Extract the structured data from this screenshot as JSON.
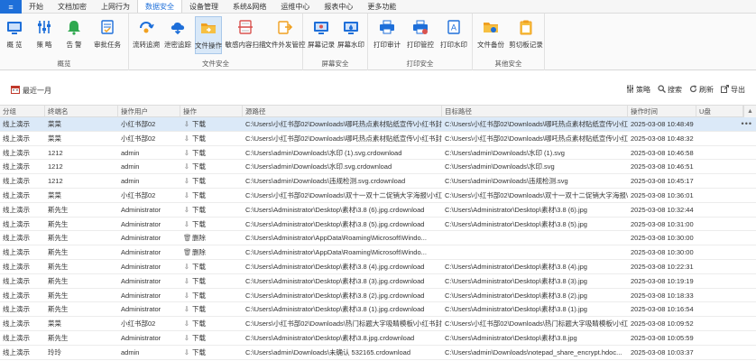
{
  "menubar": {
    "app_label": "≡",
    "tabs": [
      "开始",
      "文档加密",
      "上网行为",
      "数据安全",
      "设备管理",
      "系统&网络",
      "运维中心",
      "报表中心",
      "更多功能"
    ],
    "active_tab": "数据安全"
  },
  "ribbon": {
    "groups": [
      {
        "label": "概览",
        "buttons": [
          {
            "label": "概 览",
            "icon": "overview-icon"
          },
          {
            "label": "策 略",
            "icon": "policy-icon"
          },
          {
            "label": "告 警",
            "icon": "bell-icon"
          },
          {
            "label": "审批任务",
            "icon": "approval-icon"
          }
        ]
      },
      {
        "label": "文件安全",
        "buttons": [
          {
            "label": "流转追溯",
            "icon": "trace-icon"
          },
          {
            "label": "泄密追踪",
            "icon": "leak-icon"
          },
          {
            "label": "文件操作",
            "icon": "folder-icon"
          },
          {
            "label": "敏感内容扫描",
            "icon": "scan-icon"
          },
          {
            "label": "文件外发管控",
            "icon": "outgoing-icon"
          }
        ]
      },
      {
        "label": "屏幕安全",
        "buttons": [
          {
            "label": "屏幕记录",
            "icon": "screen-record-icon"
          },
          {
            "label": "屏幕水印",
            "icon": "watermark-icon"
          }
        ]
      },
      {
        "label": "打印安全",
        "buttons": [
          {
            "label": "打印审计",
            "icon": "printer-icon"
          },
          {
            "label": "打印管控",
            "icon": "print-control-icon"
          },
          {
            "label": "打印水印",
            "icon": "print-watermark-icon"
          }
        ]
      },
      {
        "label": "其他安全",
        "buttons": [
          {
            "label": "文件备份",
            "icon": "backup-icon"
          },
          {
            "label": "剪切板记录",
            "icon": "clipboard-icon"
          }
        ]
      }
    ],
    "active_button": "文件操作",
    "colors": {
      "blue": "#1e6fd9",
      "green": "#2fa84f",
      "orange": "#f0a020",
      "red": "#d9534f",
      "active_bg": "#d8e8f8"
    }
  },
  "toolbar": {
    "range_label": "最近一月",
    "tools": [
      {
        "label": "策略",
        "icon": "filter-icon"
      },
      {
        "label": "搜索",
        "icon": "search-icon"
      },
      {
        "label": "刷新",
        "icon": "refresh-icon"
      },
      {
        "label": "导出",
        "icon": "export-icon"
      }
    ]
  },
  "table": {
    "columns": [
      "分组",
      "终端名",
      "操作用户",
      "操作",
      "源路径",
      "目标路径",
      "操作时间",
      "U盘"
    ],
    "rows": [
      {
        "group": "线上演示",
        "terminal": "菜菜",
        "user": "小红书部02",
        "op": "下载",
        "op_icon": "download-icon",
        "src": "C:\\Users\\小红书部02\\Downloads\\哪吒热点素材贴纸宣传\\小红书封",
        "dst": "C:\\Users\\小红书部02\\Downloads\\哪吒热点素材贴纸宣传\\小红",
        "time": "2025-03-08 10:48:49",
        "selected": true
      },
      {
        "group": "线上演示",
        "terminal": "菜菜",
        "user": "小红书部02",
        "op": "下载",
        "op_icon": "download-icon",
        "src": "C:\\Users\\小红书部02\\Downloads\\哪吒热点素材贴纸宣传\\小红书封",
        "dst": "C:\\Users\\小红书部02\\Downloads\\哪吒热点素材贴纸宣传\\小红",
        "time": "2025-03-08 10:48:32",
        "selected": false
      },
      {
        "group": "线上演示",
        "terminal": "1212",
        "user": "admin",
        "op": "下载",
        "op_icon": "download-icon",
        "src": "C:\\Users\\admin\\Downloads\\水印 (1).svg.crdownload",
        "dst": "C:\\Users\\admin\\Downloads\\水印 (1).svg",
        "time": "2025-03-08 10:46:58",
        "selected": false
      },
      {
        "group": "线上演示",
        "terminal": "1212",
        "user": "admin",
        "op": "下载",
        "op_icon": "download-icon",
        "src": "C:\\Users\\admin\\Downloads\\水印.svg.crdownload",
        "dst": "C:\\Users\\admin\\Downloads\\水印.svg",
        "time": "2025-03-08 10:46:51",
        "selected": false
      },
      {
        "group": "线上演示",
        "terminal": "1212",
        "user": "admin",
        "op": "下载",
        "op_icon": "download-icon",
        "src": "C:\\Users\\admin\\Downloads\\违规检测.svg.crdownload",
        "dst": "C:\\Users\\admin\\Downloads\\违规检测.svg",
        "time": "2025-03-08 10:45:17",
        "selected": false
      },
      {
        "group": "线上演示",
        "terminal": "菜菜",
        "user": "小红书部02",
        "op": "下载",
        "op_icon": "download-icon",
        "src": "C:\\Users\\小红书部02\\Downloads\\双十一双十二促销大字海报\\小红书",
        "dst": "C:\\Users\\小红书部02\\Downloads\\双十一双十二促销大字海报\\",
        "time": "2025-03-08 10:36:01",
        "selected": false
      },
      {
        "group": "线上演示",
        "terminal": "斯先生",
        "user": "Administrator",
        "op": "下载",
        "op_icon": "download-icon",
        "src": "C:\\Users\\Administrator\\Desktop\\素材\\3.8 (6).jpg.crdownload",
        "dst": "C:\\Users\\Administrator\\Desktop\\素材\\3.8 (6).jpg",
        "time": "2025-03-08 10:32:44",
        "selected": false
      },
      {
        "group": "线上演示",
        "terminal": "斯先生",
        "user": "Administrator",
        "op": "下载",
        "op_icon": "download-icon",
        "src": "C:\\Users\\Administrator\\Desktop\\素材\\3.8 (5).jpg.crdownload",
        "dst": "C:\\Users\\Administrator\\Desktop\\素材\\3.8 (5).jpg",
        "time": "2025-03-08 10:31:00",
        "selected": false
      },
      {
        "group": "线上演示",
        "terminal": "斯先生",
        "user": "Administrator",
        "op": "删除",
        "op_icon": "trash-icon",
        "src": "C:\\Users\\Administrator\\AppData\\Roaming\\Microsoft\\Windo...",
        "dst": "",
        "time": "2025-03-08 10:30:00",
        "selected": false
      },
      {
        "group": "线上演示",
        "terminal": "斯先生",
        "user": "Administrator",
        "op": "删除",
        "op_icon": "trash-icon",
        "src": "C:\\Users\\Administrator\\AppData\\Roaming\\Microsoft\\Windo...",
        "dst": "",
        "time": "2025-03-08 10:30:00",
        "selected": false
      },
      {
        "group": "线上演示",
        "terminal": "斯先生",
        "user": "Administrator",
        "op": "下载",
        "op_icon": "download-icon",
        "src": "C:\\Users\\Administrator\\Desktop\\素材\\3.8 (4).jpg.crdownload",
        "dst": "C:\\Users\\Administrator\\Desktop\\素材\\3.8 (4).jpg",
        "time": "2025-03-08 10:22:31",
        "selected": false
      },
      {
        "group": "线上演示",
        "terminal": "斯先生",
        "user": "Administrator",
        "op": "下载",
        "op_icon": "download-icon",
        "src": "C:\\Users\\Administrator\\Desktop\\素材\\3.8 (3).jpg.crdownload",
        "dst": "C:\\Users\\Administrator\\Desktop\\素材\\3.8 (3).jpg",
        "time": "2025-03-08 10:19:19",
        "selected": false
      },
      {
        "group": "线上演示",
        "terminal": "斯先生",
        "user": "Administrator",
        "op": "下载",
        "op_icon": "download-icon",
        "src": "C:\\Users\\Administrator\\Desktop\\素材\\3.8 (2).jpg.crdownload",
        "dst": "C:\\Users\\Administrator\\Desktop\\素材\\3.8 (2).jpg",
        "time": "2025-03-08 10:18:33",
        "selected": false
      },
      {
        "group": "线上演示",
        "terminal": "斯先生",
        "user": "Administrator",
        "op": "下载",
        "op_icon": "download-icon",
        "src": "C:\\Users\\Administrator\\Desktop\\素材\\3.8 (1).jpg.crdownload",
        "dst": "C:\\Users\\Administrator\\Desktop\\素材\\3.8 (1).jpg",
        "time": "2025-03-08 10:16:54",
        "selected": false
      },
      {
        "group": "线上演示",
        "terminal": "菜菜",
        "user": "小红书部02",
        "op": "下载",
        "op_icon": "download-icon",
        "src": "C:\\Users\\小红书部02\\Downloads\\热门标题大字吸睛模板\\小红书封",
        "dst": "C:\\Users\\小红书部02\\Downloads\\热门标题大字吸睛模板\\小红",
        "time": "2025-03-08 10:09:52",
        "selected": false
      },
      {
        "group": "线上演示",
        "terminal": "斯先生",
        "user": "Administrator",
        "op": "下载",
        "op_icon": "download-icon",
        "src": "C:\\Users\\Administrator\\Desktop\\素材\\3.8.jpg.crdownload",
        "dst": "C:\\Users\\Administrator\\Desktop\\素材\\3.8.jpg",
        "time": "2025-03-08 10:05:59",
        "selected": false
      },
      {
        "group": "线上演示",
        "terminal": "玲玲",
        "user": "admin",
        "op": "下载",
        "op_icon": "download-icon",
        "src": "C:\\Users\\admin\\Downloads\\未确认 532165.crdownload",
        "dst": "C:\\Users\\admin\\Downloads\\notepad_share_encrypt.hdoc...",
        "time": "2025-03-08 10:03:37",
        "selected": false
      }
    ]
  }
}
